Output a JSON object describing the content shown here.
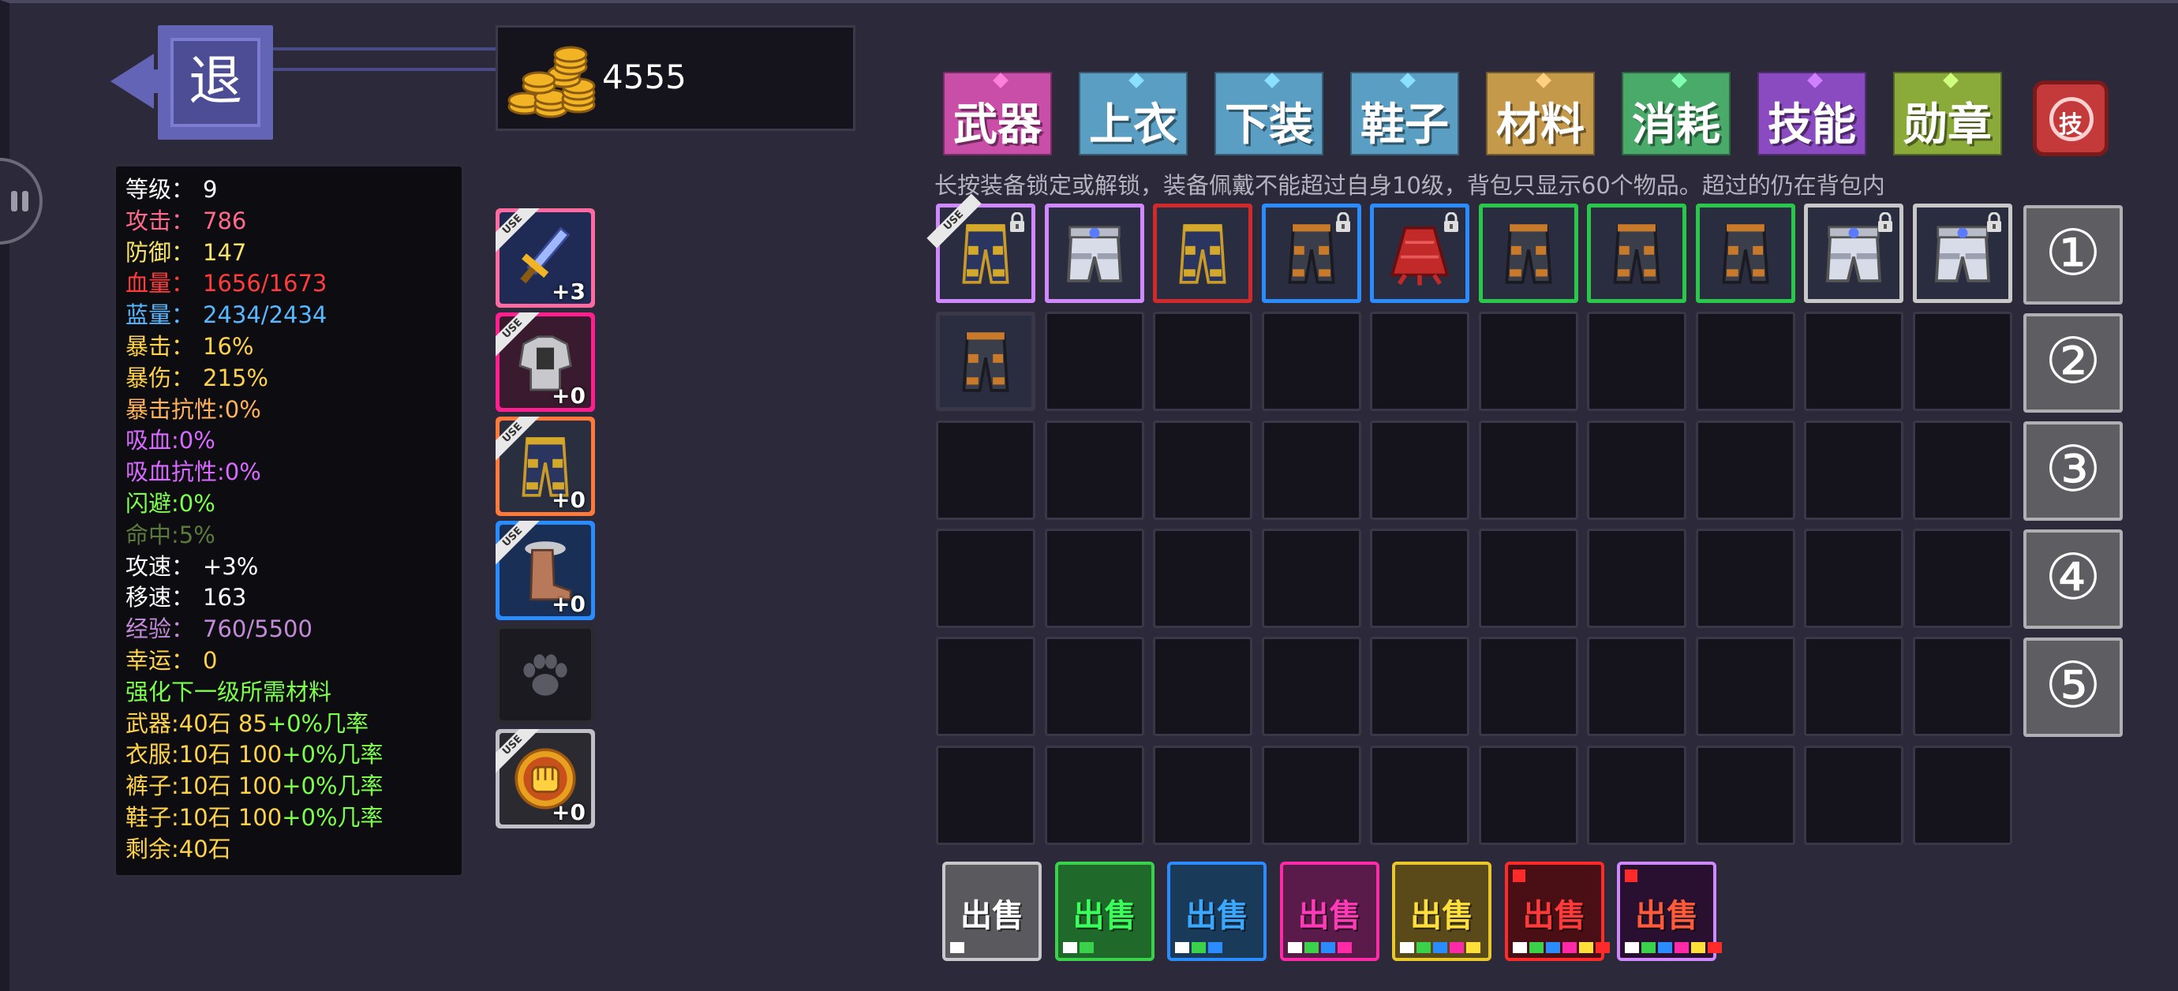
{
  "back_button": {
    "label": "退"
  },
  "gold": {
    "amount": "4555",
    "icon": "gold-coins-icon"
  },
  "stats": [
    {
      "label": "等级：",
      "value": "9",
      "color": "#ffffff",
      "value_color": "#ffffff"
    },
    {
      "label": "攻击：",
      "value": "786",
      "color": "#ff6a8c",
      "value_color": "#ff6a8c"
    },
    {
      "label": "防御：",
      "value": "147",
      "color": "#f7e36a",
      "value_color": "#f7e36a"
    },
    {
      "label": "血量：",
      "value": "1656/1673",
      "color": "#ff3b3b",
      "value_color": "#ff3b3b"
    },
    {
      "label": "蓝量：",
      "value": "2434/2434",
      "color": "#58b8ff",
      "value_color": "#58b8ff"
    },
    {
      "label": "暴击：",
      "value": "16%",
      "color": "#ffd24a",
      "value_color": "#ffd24a"
    },
    {
      "label": "暴伤：",
      "value": "215%",
      "color": "#ffd24a",
      "value_color": "#ffd24a"
    },
    {
      "label": "暴击抗性:",
      "value": "0%",
      "color": "#ffb25a",
      "value_color": "#ffb25a"
    },
    {
      "label": "吸血:",
      "value": "0%",
      "color": "#d86aff",
      "value_color": "#d86aff"
    },
    {
      "label": "吸血抗性:",
      "value": "0%",
      "color": "#d86aff",
      "value_color": "#d86aff"
    },
    {
      "label": "闪避:",
      "value": "0%",
      "color": "#7cff4a",
      "value_color": "#7cff4a"
    },
    {
      "label": "命中:",
      "value": "5%",
      "color": "#5a7a3a",
      "value_color": "#5a7a3a"
    },
    {
      "label": "攻速：",
      "value": "+3%",
      "color": "#ffffff",
      "value_color": "#ffffff"
    },
    {
      "label": "移速：",
      "value": "163",
      "color": "#ffffff",
      "value_color": "#ffffff"
    },
    {
      "label": "经验：",
      "value": "760/5500",
      "color": "#c28ad8",
      "value_color": "#c28ad8"
    },
    {
      "label": "幸运：",
      "value": "0",
      "color": "#ffd24a",
      "value_color": "#ffd24a"
    },
    {
      "label": "强化下一级所需材料",
      "value": "",
      "color": "#7cff4a",
      "value_color": "#7cff4a"
    },
    {
      "label": "武器:40石 85",
      "value": "+0%几率",
      "color": "#ffd24a",
      "value_color": "#7cff4a"
    },
    {
      "label": "衣服:10石 100",
      "value": "+0%几率",
      "color": "#ffd24a",
      "value_color": "#7cff4a"
    },
    {
      "label": "裤子:10石 100",
      "value": "+0%几率",
      "color": "#ffd24a",
      "value_color": "#7cff4a"
    },
    {
      "label": "鞋子:10石 100",
      "value": "+0%几率",
      "color": "#ffd24a",
      "value_color": "#7cff4a"
    },
    {
      "label": "剩余:40石",
      "value": "",
      "color": "#ffd24a",
      "value_color": "#ffd24a"
    }
  ],
  "equipped": [
    {
      "name": "weapon",
      "icon": "sword-icon",
      "use": "USE",
      "level": "+3",
      "border": "#ff6aa0",
      "bg": "#1f2a55"
    },
    {
      "name": "armor",
      "icon": "chest-armor-icon",
      "use": "USE",
      "level": "+0",
      "border": "#ff1f8f",
      "bg": "#3a1a2f"
    },
    {
      "name": "pants",
      "icon": "gold-pants-icon",
      "use": "USE",
      "level": "+0",
      "border": "#ff7a3a",
      "bg": "#2a2f40"
    },
    {
      "name": "boots",
      "icon": "boots-icon",
      "use": "USE",
      "level": "+0",
      "border": "#2a8cff",
      "bg": "#1a2f55"
    },
    {
      "name": "pet",
      "icon": "paw-icon",
      "use": "",
      "level": "",
      "border": "#2a2a30",
      "bg": "#1a1a20"
    },
    {
      "name": "skill",
      "icon": "fist-icon",
      "use": "USE",
      "level": "+0",
      "border": "#c0c0c8",
      "bg": "#2a2a30"
    }
  ],
  "tabs": [
    {
      "label": "武器",
      "color": "#c84ea8",
      "gem": "#ff80d8"
    },
    {
      "label": "上衣",
      "color": "#5a9ec4",
      "gem": "#8ae0ff"
    },
    {
      "label": "下装",
      "color": "#5a9ec4",
      "gem": "#8ae0ff"
    },
    {
      "label": "鞋子",
      "color": "#5a9ec4",
      "gem": "#8ae0ff"
    },
    {
      "label": "材料",
      "color": "#c49a4a",
      "gem": "#ffd080"
    },
    {
      "label": "消耗",
      "color": "#4aaa6a",
      "gem": "#80ffb0"
    },
    {
      "label": "技能",
      "color": "#8a4ac0",
      "gem": "#d080ff"
    },
    {
      "label": "勋章",
      "color": "#8aaa3a",
      "gem": "#d0ff80"
    }
  ],
  "skill_button": {
    "label": "技",
    "icon": "rotate-skill-icon"
  },
  "hint": "长按装备锁定或解锁，装备佩戴不能超过自身10级，背包只显示60个物品。超过的仍在背包内",
  "inventory": [
    {
      "icon": "gold-pants-icon",
      "border": "#d088ff",
      "locked": true,
      "use": "USE"
    },
    {
      "icon": "silver-pants-icon",
      "border": "#d088ff",
      "locked": false,
      "use": ""
    },
    {
      "icon": "gold-pants-icon",
      "border": "#d02a2a",
      "locked": false,
      "use": ""
    },
    {
      "icon": "dark-pants-icon",
      "border": "#2a8cff",
      "locked": true,
      "use": ""
    },
    {
      "icon": "red-skirt-icon",
      "border": "#2a8cff",
      "locked": true,
      "use": ""
    },
    {
      "icon": "dark-pants-icon",
      "border": "#2ac84a",
      "locked": false,
      "use": ""
    },
    {
      "icon": "dark-pants-icon",
      "border": "#2ac84a",
      "locked": false,
      "use": ""
    },
    {
      "icon": "dark-pants-icon",
      "border": "#2ac84a",
      "locked": false,
      "use": ""
    },
    {
      "icon": "silver-pants-icon",
      "border": "#c8c8c8",
      "locked": true,
      "use": ""
    },
    {
      "icon": "silver-pants-icon",
      "border": "#c8c8c8",
      "locked": true,
      "use": ""
    },
    {
      "icon": "dark-pants-icon",
      "border": "#3a3848",
      "locked": false,
      "use": ""
    }
  ],
  "pages": [
    "①",
    "②",
    "③",
    "④",
    "⑤"
  ],
  "sell_buttons": [
    {
      "label": "出售",
      "bg": "#5a5a5e",
      "border": "#c8c8cc",
      "text": "#ffffff",
      "dots": [
        "#ffffff"
      ]
    },
    {
      "label": "出售",
      "bg": "#1f6a2a",
      "border": "#3ad24a",
      "text": "#3aff5a",
      "dots": [
        "#ffffff",
        "#3ad24a"
      ]
    },
    {
      "label": "出售",
      "bg": "#1a3a5a",
      "border": "#2a8cff",
      "text": "#3aa8ff",
      "dots": [
        "#ffffff",
        "#3ad24a",
        "#2a8cff"
      ]
    },
    {
      "label": "出售",
      "bg": "#5a1a4a",
      "border": "#ff2aa8",
      "text": "#ff3ab8",
      "dots": [
        "#ffffff",
        "#3ad24a",
        "#2a8cff",
        "#ff2aa8"
      ]
    },
    {
      "label": "出售",
      "bg": "#5a4a1a",
      "border": "#e8c82a",
      "text": "#ffe03a",
      "dots": [
        "#ffffff",
        "#3ad24a",
        "#2a8cff",
        "#ff2aa8",
        "#ffe03a"
      ]
    },
    {
      "label": "出售",
      "bg": "#4a0f14",
      "border": "#ff2a2a",
      "text": "#ff3a3a",
      "dots": [
        "#ffffff",
        "#3ad24a",
        "#2a8cff",
        "#ff2aa8",
        "#ffe03a",
        "#ff2a2a"
      ]
    },
    {
      "label": "出售",
      "bg": "#2a1030",
      "border": "#d088ff",
      "text": "#ff5a3a",
      "dots": [
        "#ffffff",
        "#3ad24a",
        "#2a8cff",
        "#ff2aa8",
        "#ffe03a",
        "#ff2a2a"
      ]
    }
  ]
}
